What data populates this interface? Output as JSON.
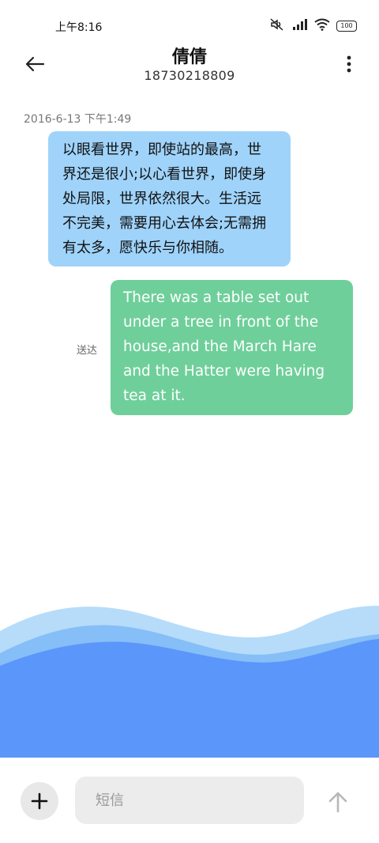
{
  "status_bar": {
    "time": "上午8:16",
    "battery": "100",
    "icons": [
      "mute-icon",
      "signal-icon",
      "wifi-icon",
      "battery-icon"
    ]
  },
  "header": {
    "contact_name": "倩倩",
    "phone_number": "18730218809",
    "back_icon": "arrow-left-icon",
    "menu_icon": "more-vertical-icon"
  },
  "conversation": {
    "timestamp": "2016-6-13 下午1:49",
    "messages": [
      {
        "direction": "incoming",
        "color": "#9fd3fa",
        "lines": [
          "以眼看世界，即使站的最高，世",
          "界还是很小;以心看世界，即使身",
          "处局限，世界依然很大。生活远",
          "不完美，需要用心去体会;无需拥",
          "有太多，愿快乐与你相随。"
        ]
      },
      {
        "direction": "outgoing",
        "color": "#6fcf9a",
        "status": "送达",
        "lines": [
          "There was a table set out",
          "under a tree in front of the",
          "house,and the March Hare",
          "and the Hatter were having",
          "tea at it."
        ]
      }
    ]
  },
  "composer": {
    "add_icon": "plus-icon",
    "placeholder": "短信",
    "value": "",
    "send_icon": "arrow-up-icon"
  },
  "colors": {
    "wave_light": "#b6dcfa",
    "wave_mid": "#86bef7",
    "wave_dark": "#5b96fb"
  }
}
